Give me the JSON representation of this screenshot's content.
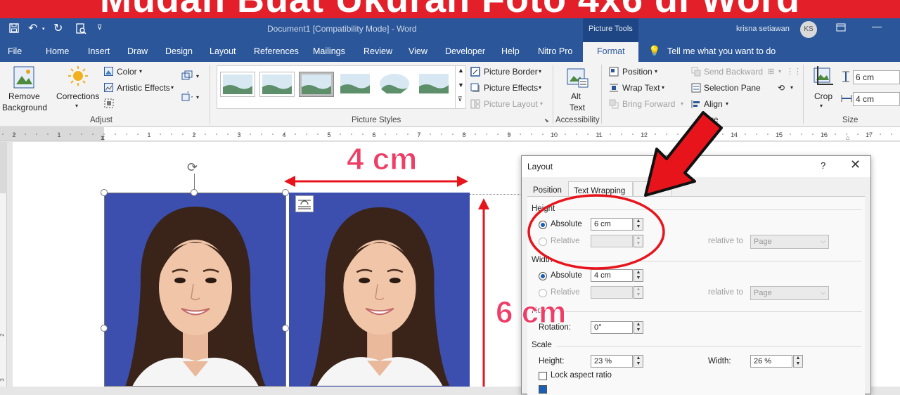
{
  "banner": {
    "text": "Mudah Buat Ukuran Foto 4x6 di Word"
  },
  "titlebar": {
    "doc_title": "Document1 [Compatibility Mode]  -  Word",
    "context_tab": "Picture Tools",
    "user": "krisna setiawan",
    "initials": "KS"
  },
  "menu": {
    "items": [
      "File",
      "Home",
      "Insert",
      "Draw",
      "Design",
      "Layout",
      "References",
      "Mailings",
      "Review",
      "View",
      "Developer",
      "Help",
      "Nitro Pro"
    ],
    "active": "Format",
    "tell_me": "Tell me what you want to do"
  },
  "ribbon": {
    "remove_bg": "Remove Background",
    "corrections": "Corrections",
    "color": "Color",
    "artistic": "Artistic Effects",
    "adjust_group": "Adjust",
    "styles_group": "Picture Styles",
    "picture_border": "Picture Border",
    "picture_effects": "Picture Effects",
    "picture_layout": "Picture Layout",
    "alt_text": "Alt Text",
    "accessibility_group": "Accessibility",
    "position": "Position",
    "wrap_text": "Wrap Text",
    "bring_forward": "Bring Forward",
    "send_backward": "Send Backward",
    "selection_pane": "Selection Pane",
    "align": "Align",
    "arrange_group_partial": "ange",
    "crop": "Crop",
    "height": "6 cm",
    "width": "4 cm",
    "size_group": "Size"
  },
  "ruler": {
    "labels": [
      "2",
      "1",
      "1",
      "2",
      "3",
      "4",
      "5",
      "6",
      "7",
      "8",
      "9",
      "10",
      "11",
      "12",
      "13",
      "14",
      "15",
      "16",
      "17"
    ]
  },
  "annotations": {
    "width": "4 cm",
    "height": "6 cm"
  },
  "dialog": {
    "title": "Layout",
    "help": "?",
    "tabs": [
      "Position",
      "Text Wrapping"
    ],
    "height_section": "Height",
    "absolute": "Absolute",
    "relative": "Relative",
    "height_value": "6 cm",
    "relative_to": "relative to",
    "page": "Page",
    "width_section": "Width",
    "width_value": "4 cm",
    "rotate_section_partial": "Rot",
    "rotation_label": "Rotation:",
    "rotation_value": "0°",
    "scale_section": "Scale",
    "scale_height_label": "Height:",
    "scale_height_value": "23 %",
    "scale_width_label": "Width:",
    "scale_width_value": "26 %",
    "lock_aspect": "Lock aspect ratio"
  },
  "colors": {
    "word_blue": "#2b579a",
    "photo_bg": "#3c4fae",
    "annotation": "#ee3e67",
    "arrow_red": "#e8141c",
    "banner_red": "#e3202a"
  }
}
